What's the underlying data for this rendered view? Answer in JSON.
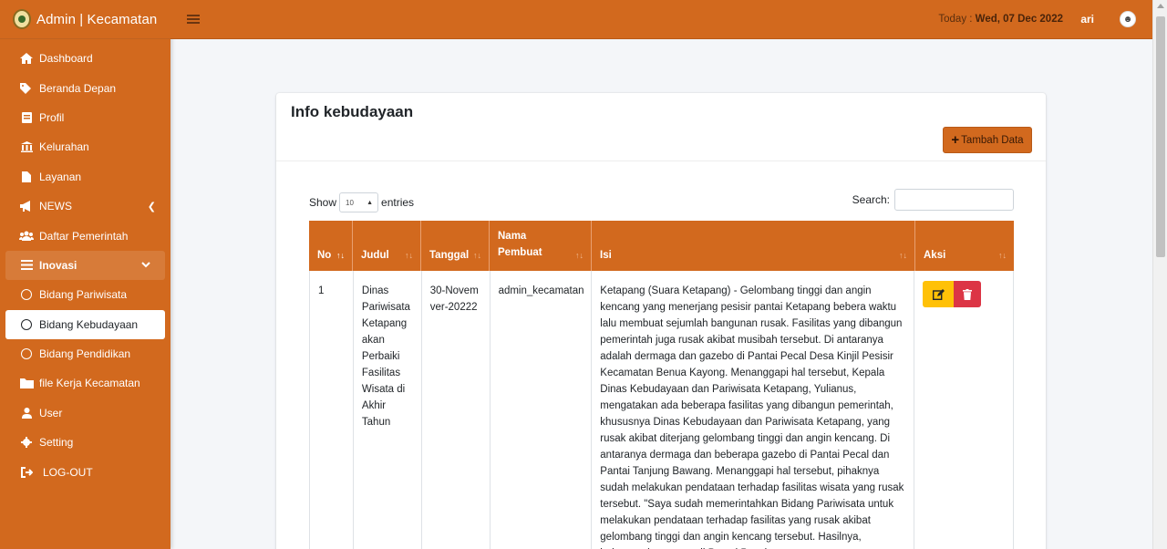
{
  "brand": {
    "title": "Admin | Kecamatan"
  },
  "sidebar": {
    "items": [
      {
        "label": "Dashboard",
        "icon": "home-icon"
      },
      {
        "label": "Beranda Depan",
        "icon": "tags-icon"
      },
      {
        "label": "Profil",
        "icon": "book-icon"
      },
      {
        "label": "Kelurahan",
        "icon": "building-icon"
      },
      {
        "label": "Layanan",
        "icon": "file-icon"
      },
      {
        "label": "NEWS",
        "icon": "megaphone-icon"
      },
      {
        "label": "Daftar Pemerintah",
        "icon": "users-icon"
      },
      {
        "label": "Inovasi",
        "icon": "list-icon"
      },
      {
        "label": "Bidang Pariwisata",
        "icon": "circle-icon"
      },
      {
        "label": "Bidang Kebudayaan",
        "icon": "circle-icon"
      },
      {
        "label": "Bidang Pendidikan",
        "icon": "circle-icon"
      },
      {
        "label": "file Kerja Kecamatan",
        "icon": "folder-icon"
      },
      {
        "label": "User",
        "icon": "user-icon"
      },
      {
        "label": "Setting",
        "icon": "gear-icon"
      },
      {
        "label": "LOG-OUT",
        "icon": "logout-icon"
      }
    ]
  },
  "topbar": {
    "today_label": "Today :",
    "today_date": "Wed, 07 Dec 2022",
    "username": "ari"
  },
  "card": {
    "title": "Info kebudayaan",
    "add_button": "Tambah Data"
  },
  "controls": {
    "show_label": "Show",
    "entries_value": "10",
    "entries_label": "entries",
    "search_label": "Search:"
  },
  "table": {
    "headers": [
      "No",
      "Judul",
      "Tanggal",
      "Nama Pembuat",
      "Isi",
      "Aksi"
    ],
    "rows": [
      {
        "no": "1",
        "judul": "Dinas Pariwisata Ketapang akan Perbaiki Fasilitas Wisata di Akhir Tahun",
        "tanggal": "30-Novemver-20222",
        "pembuat": "admin_kecamatan",
        "isi": "Ketapang (Suara Ketapang) - Gelombang tinggi dan angin kencang yang menerjang pesisir pantai Ketapang bebera waktu lalu membuat sejumlah bangunan rusak. Fasilitas yang dibangun pemerintah juga rusak akibat musibah tersebut. Di antaranya adalah dermaga dan gazebo di Pantai Pecal Desa Kinjil Pesisir Kecamatan Benua Kayong. Menanggapi hal tersebut, Kepala Dinas Kebudayaan dan Pariwisata Ketapang, Yulianus, mengatakan ada beberapa fasilitas yang dibangun pemerintah, khususnya Dinas Kebudayaan dan Pariwisata Ketapang, yang rusak akibat diterjang gelombang tinggi dan angin kencang. Di antaranya dermaga dan beberapa gazebo di Pantai Pecal dan Pantai Tanjung Bawang. Menanggapi hal tersebut, pihaknya sudah melakukan pendataan terhadap fasilitas wisata yang rusak tersebut. \"Saya sudah memerintahkan Bidang Pariwisata untuk melakukan pendataan terhadap fasilitas yang rusak akibat gelombang tinggi dan angin kencang tersebut. Hasilnya, beberapa bangunan di Pantai Pecal"
      }
    ]
  },
  "colors": {
    "primary": "#d2691e",
    "edit": "#ffc107",
    "delete": "#dc3545"
  }
}
